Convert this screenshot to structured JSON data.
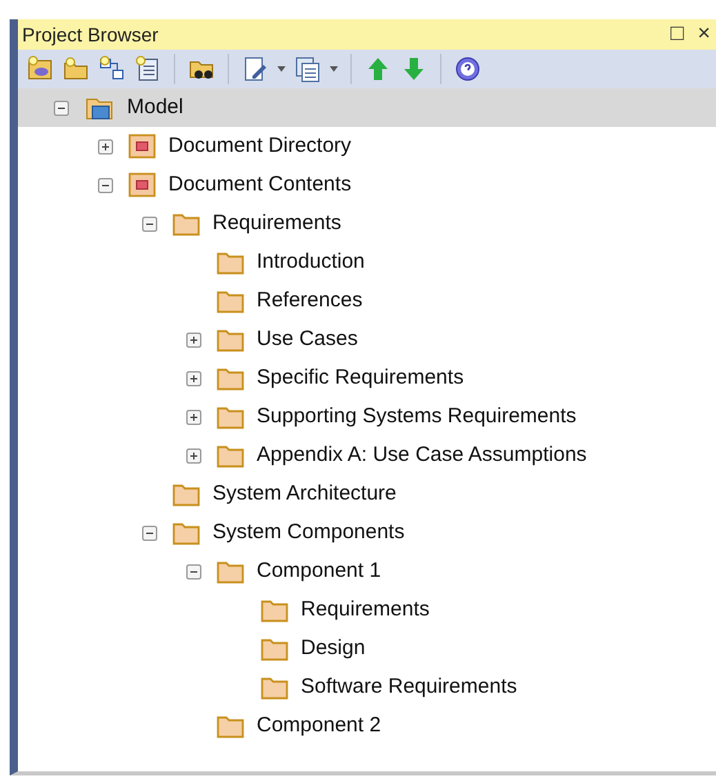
{
  "window": {
    "title": "Project Browser",
    "controls": [
      "□",
      "×"
    ]
  },
  "toolbar": [
    {
      "kind": "new-model"
    },
    {
      "kind": "new-package"
    },
    {
      "kind": "new-diagram"
    },
    {
      "kind": "new-element"
    },
    {
      "kind": "find"
    },
    {
      "kind": "edit",
      "dropdown": true
    },
    {
      "kind": "documents",
      "dropdown": true
    },
    {
      "kind": "move-up"
    },
    {
      "kind": "move-down"
    },
    {
      "kind": "help"
    }
  ],
  "tree": {
    "label": "Model",
    "kind": "model",
    "expanded": true,
    "children": [
      {
        "label": "Document Directory",
        "kind": "document",
        "expanded": false
      },
      {
        "label": "Document Contents",
        "kind": "document",
        "expanded": true,
        "children": [
          {
            "label": "Requirements",
            "kind": "folder",
            "expanded": true,
            "children": [
              {
                "label": "Introduction",
                "kind": "folder"
              },
              {
                "label": "References",
                "kind": "folder"
              },
              {
                "label": "Use Cases",
                "kind": "folder",
                "expanded": false
              },
              {
                "label": "Specific Requirements",
                "kind": "folder",
                "expanded": false
              },
              {
                "label": "Supporting Systems Requirements",
                "kind": "folder",
                "expanded": false
              },
              {
                "label": "Appendix A: Use Case Assumptions",
                "kind": "folder",
                "expanded": false
              }
            ]
          },
          {
            "label": "System Architecture",
            "kind": "folder"
          },
          {
            "label": "System Components",
            "kind": "folder",
            "expanded": true,
            "children": [
              {
                "label": "Component 1",
                "kind": "folder",
                "expanded": true,
                "children": [
                  {
                    "label": "Requirements",
                    "kind": "folder"
                  },
                  {
                    "label": "Design",
                    "kind": "folder"
                  },
                  {
                    "label": "Software Requirements",
                    "kind": "folder"
                  }
                ]
              },
              {
                "label": "Component 2",
                "kind": "folder"
              }
            ]
          }
        ]
      }
    ]
  }
}
